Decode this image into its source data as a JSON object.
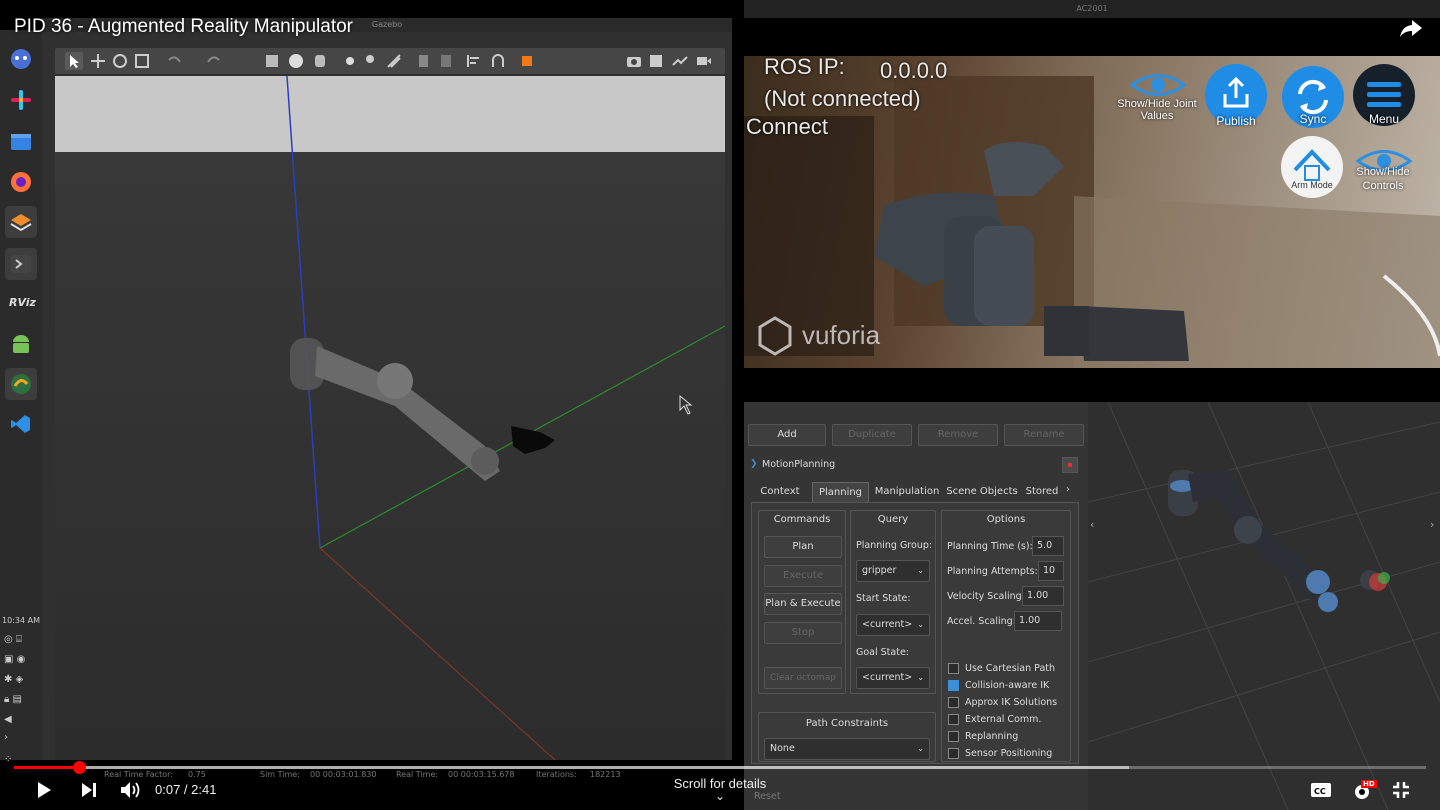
{
  "video": {
    "title": "PID 36 - Augmented Reality Manipulator",
    "current_time": "0:07",
    "separator": " / ",
    "duration": "2:41",
    "played_fraction": 0.046,
    "buffered_fraction": 0.79,
    "scroll_hint": "Scroll for details",
    "hd_badge": "HD",
    "accent_color": "#ff0000"
  },
  "dock": {
    "clock": "10:34 AM",
    "rviz_label": "RViz",
    "icons": [
      "chat-bot-icon",
      "slack-icon",
      "files-icon",
      "firefox-icon",
      "stack-icon",
      "terminal-icon",
      "rviz-icon",
      "android-icon",
      "gazebo-icon",
      "vscode-icon"
    ]
  },
  "gazebo": {
    "window_title": "Gazebo",
    "status": {
      "real_time_factor_label": "Real Time Factor:",
      "real_time_factor": "0.75",
      "sim_time_label": "Sim Time:",
      "sim_time": "00 00:03:01.830",
      "real_time_label": "Real Time:",
      "real_time": "00 00:03:15.678",
      "iterations_label": "Iterations:",
      "iterations": "182213"
    }
  },
  "ar": {
    "window_title": "AC2001",
    "ros_ip_label": "ROS IP:",
    "ros_ip_value": "0.0.0.0",
    "connection_status": "(Not connected)",
    "connect_label": "Connect",
    "brand": "vuforia",
    "buttons": {
      "show_hide_joint": "Show/Hide Joint Values",
      "publish": "Publish",
      "sync": "Sync",
      "menu": "Menu",
      "arm_mode": "Arm Mode",
      "show_hide_controls_1": "Show/Hide",
      "show_hide_controls_2": "Controls"
    }
  },
  "rviz": {
    "panel_buttons": {
      "add": "Add",
      "duplicate": "Duplicate",
      "remove": "Remove",
      "rename": "Rename"
    },
    "plugin_title": "MotionPlanning",
    "tabs": [
      "Context",
      "Planning",
      "Manipulation",
      "Scene Objects",
      "Stored S"
    ],
    "active_tab": "Planning",
    "commands": {
      "title": "Commands",
      "plan": "Plan",
      "execute": "Execute",
      "plan_execute": "Plan & Execute",
      "stop": "Stop",
      "clear_octomap": "Clear octomap"
    },
    "query": {
      "title": "Query",
      "planning_group_label": "Planning Group:",
      "planning_group": "gripper",
      "start_state_label": "Start State:",
      "start_state": "<current>",
      "goal_state_label": "Goal State:",
      "goal_state": "<current>"
    },
    "options": {
      "title": "Options",
      "planning_time_label": "Planning Time (s):",
      "planning_time": "5.0",
      "planning_attempts_label": "Planning Attempts:",
      "planning_attempts": "10",
      "velocity_scaling_label": "Velocity Scaling:",
      "velocity_scaling": "1.00",
      "accel_scaling_label": "Accel. Scaling:",
      "accel_scaling": "1.00",
      "checkboxes": [
        {
          "label": "Use Cartesian Path",
          "checked": false
        },
        {
          "label": "Collision-aware IK",
          "checked": true
        },
        {
          "label": "Approx IK Solutions",
          "checked": false
        },
        {
          "label": "External Comm.",
          "checked": false
        },
        {
          "label": "Replanning",
          "checked": false
        },
        {
          "label": "Sensor Positioning",
          "checked": false
        }
      ]
    },
    "path_constraints": {
      "title": "Path Constraints",
      "value": "None"
    },
    "reset_label": "Reset"
  }
}
